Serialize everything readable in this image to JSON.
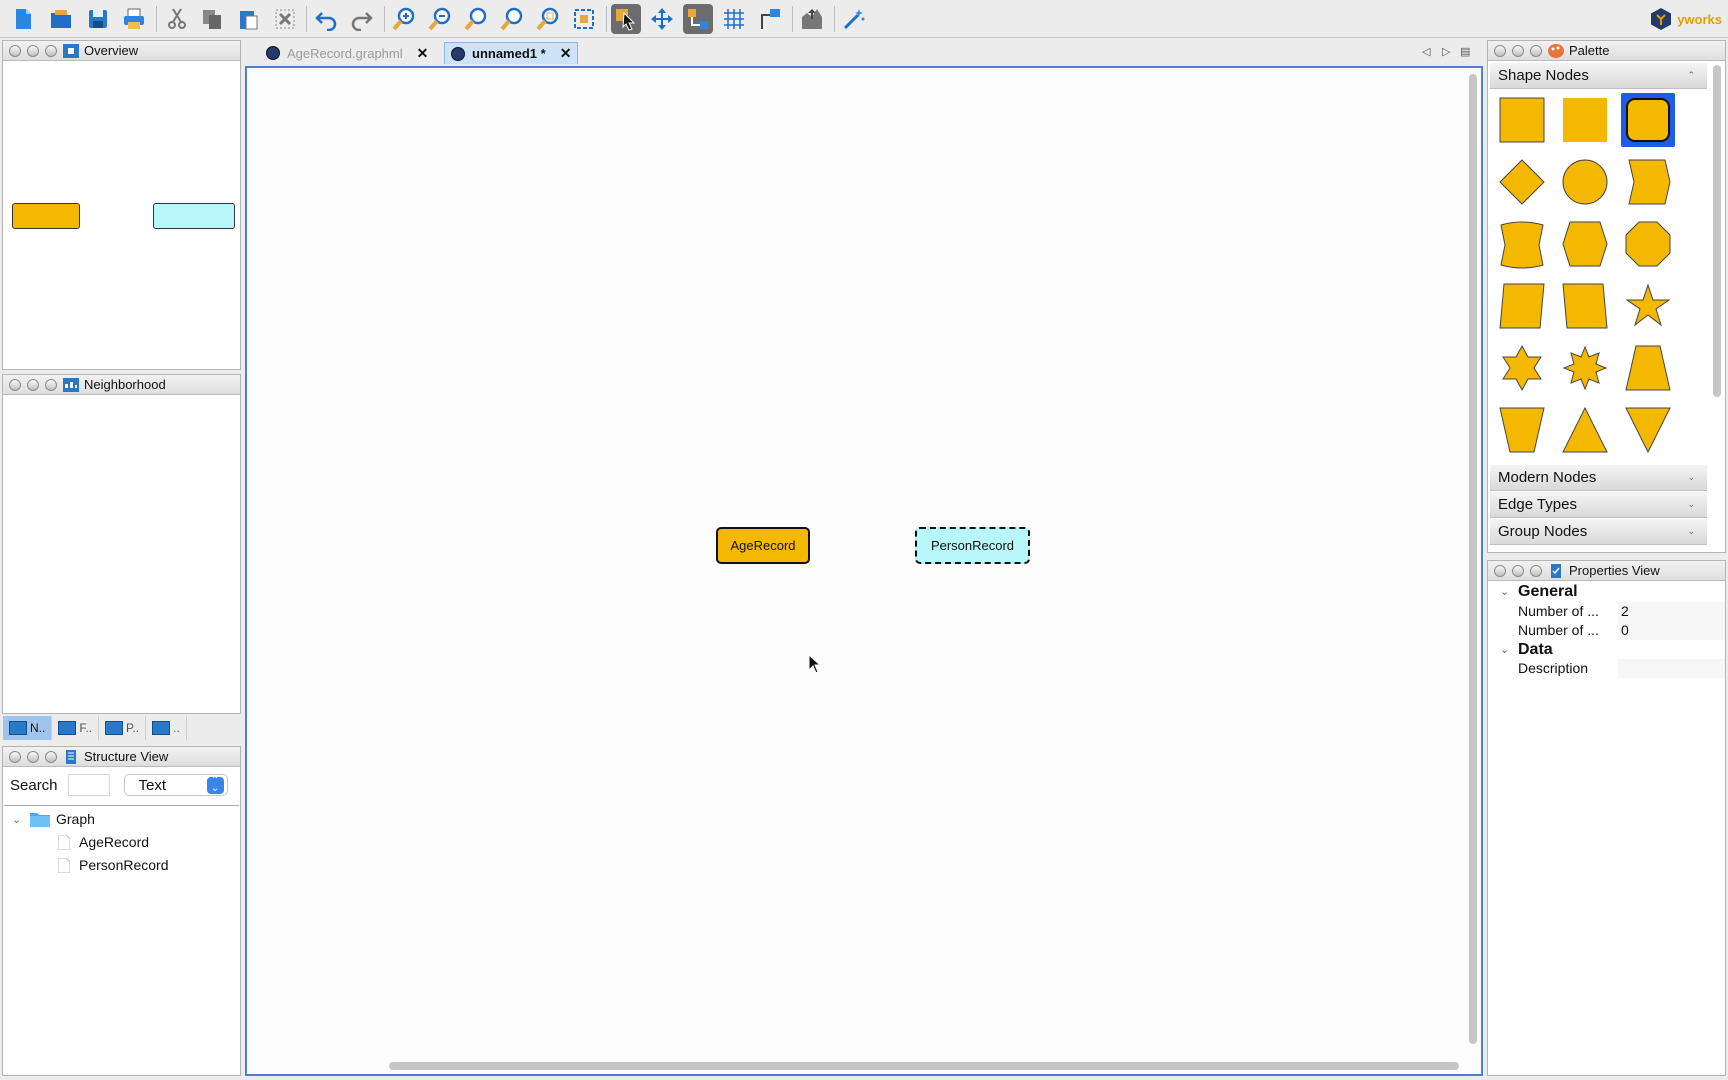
{
  "window": {
    "brand": "yworks"
  },
  "toolbar": {
    "buttons": [
      "new-document",
      "open",
      "save",
      "print",
      "cut",
      "copy",
      "paste",
      "delete",
      "undo",
      "redo",
      "zoom-in",
      "zoom-out",
      "zoom-original",
      "zoom-fit",
      "zoom-area",
      "fit-content",
      "select-mode",
      "pan-mode",
      "edge-mode",
      "grid",
      "orthogonal-edges",
      "export",
      "layout-wizard"
    ]
  },
  "overview": {
    "title": "Overview"
  },
  "neighborhood": {
    "title": "Neighborhood",
    "tabs": [
      "N..",
      "F..",
      "P..",
      ".."
    ]
  },
  "structure": {
    "title": "Structure View",
    "search_label": "Search",
    "search_value": "",
    "select_value": "Text",
    "tree": {
      "root": "Graph",
      "children": [
        "AgeRecord",
        "PersonRecord"
      ]
    }
  },
  "document_tabs": [
    {
      "label": "AgeRecord.graphml",
      "active": false
    },
    {
      "label": "unnamed1 *",
      "active": true
    }
  ],
  "canvas": {
    "nodes": [
      {
        "label": "AgeRecord",
        "fill": "#f5b800",
        "border": "solid"
      },
      {
        "label": "PersonRecord",
        "fill": "#b7f7f9",
        "border": "dashed"
      }
    ]
  },
  "palette": {
    "title": "Palette",
    "sections": [
      {
        "label": "Shape Nodes",
        "expanded": true
      },
      {
        "label": "Modern Nodes",
        "expanded": false
      },
      {
        "label": "Edge Types",
        "expanded": false
      },
      {
        "label": "Group Nodes",
        "expanded": false
      }
    ],
    "shapes": [
      "rectangle",
      "rectangle-flat",
      "round-rectangle",
      "diamond",
      "ellipse",
      "hexagon-skew",
      "parallelogram-curve",
      "octagon-flat",
      "octagon",
      "parallelogram",
      "trapezoid-lean",
      "star5",
      "star6",
      "star8",
      "trapezoid",
      "trapezoid-inverted",
      "triangle",
      "triangle-inverted"
    ],
    "fill": "#f5b800"
  },
  "properties": {
    "title": "Properties View",
    "sections": [
      {
        "label": "General",
        "rows": [
          {
            "key": "Number of ...",
            "value": "2"
          },
          {
            "key": "Number of ...",
            "value": "0"
          }
        ]
      },
      {
        "label": "Data",
        "rows": [
          {
            "key": "Description",
            "value": ""
          }
        ]
      }
    ]
  }
}
